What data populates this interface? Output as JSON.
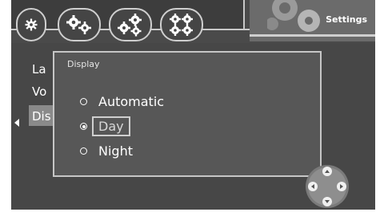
{
  "header": {
    "title": "Settings",
    "tabs": [
      {
        "icon": "gear-icon"
      },
      {
        "icon": "two-gears-icon"
      },
      {
        "icon": "three-gears-icon"
      },
      {
        "icon": "four-gears-icon"
      }
    ]
  },
  "menu": {
    "items": [
      {
        "label": "La"
      },
      {
        "label": "Vo"
      },
      {
        "label": "Dis"
      }
    ]
  },
  "display_panel": {
    "title": "Display",
    "options": [
      {
        "label": "Automatic",
        "selected": false
      },
      {
        "label": "Day",
        "selected": true
      },
      {
        "label": "Night",
        "selected": false
      }
    ]
  },
  "colors": {
    "background": "#474747",
    "panel": "#575757",
    "border": "#c8c8c8",
    "text": "#ffffff"
  }
}
